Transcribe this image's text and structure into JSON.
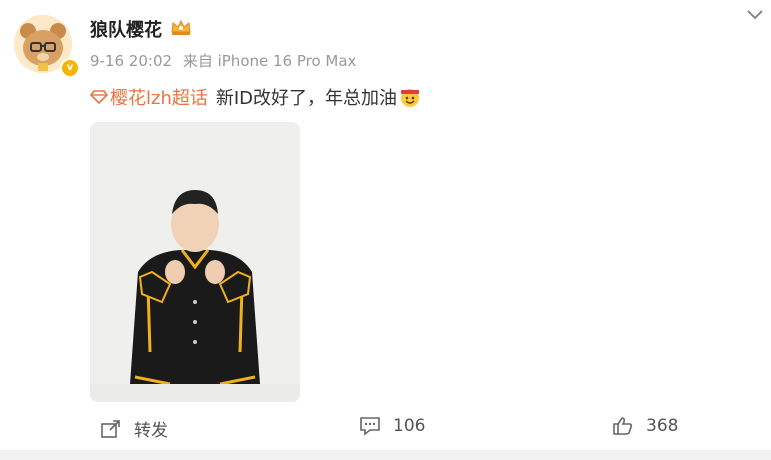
{
  "post": {
    "username": "狼队樱花",
    "time": "9-16 20:02",
    "source": "来自 iPhone 16 Pro Max",
    "topic": "樱花lzh超话",
    "text": "新ID改好了，年总加油"
  },
  "actions": {
    "repost_label": "转发",
    "comment_count": "106",
    "like_count": "368"
  },
  "colors": {
    "topic": "#eb7340",
    "verified_badge": "#f5b400",
    "meta_text": "#999999"
  },
  "icons": {
    "verified": "verified-badge-icon",
    "crown": "crown-icon",
    "topic": "diamond-topic-icon",
    "repost": "repost-icon",
    "comment": "comment-icon",
    "like": "thumbs-up-icon",
    "more": "chevron-down-icon"
  }
}
